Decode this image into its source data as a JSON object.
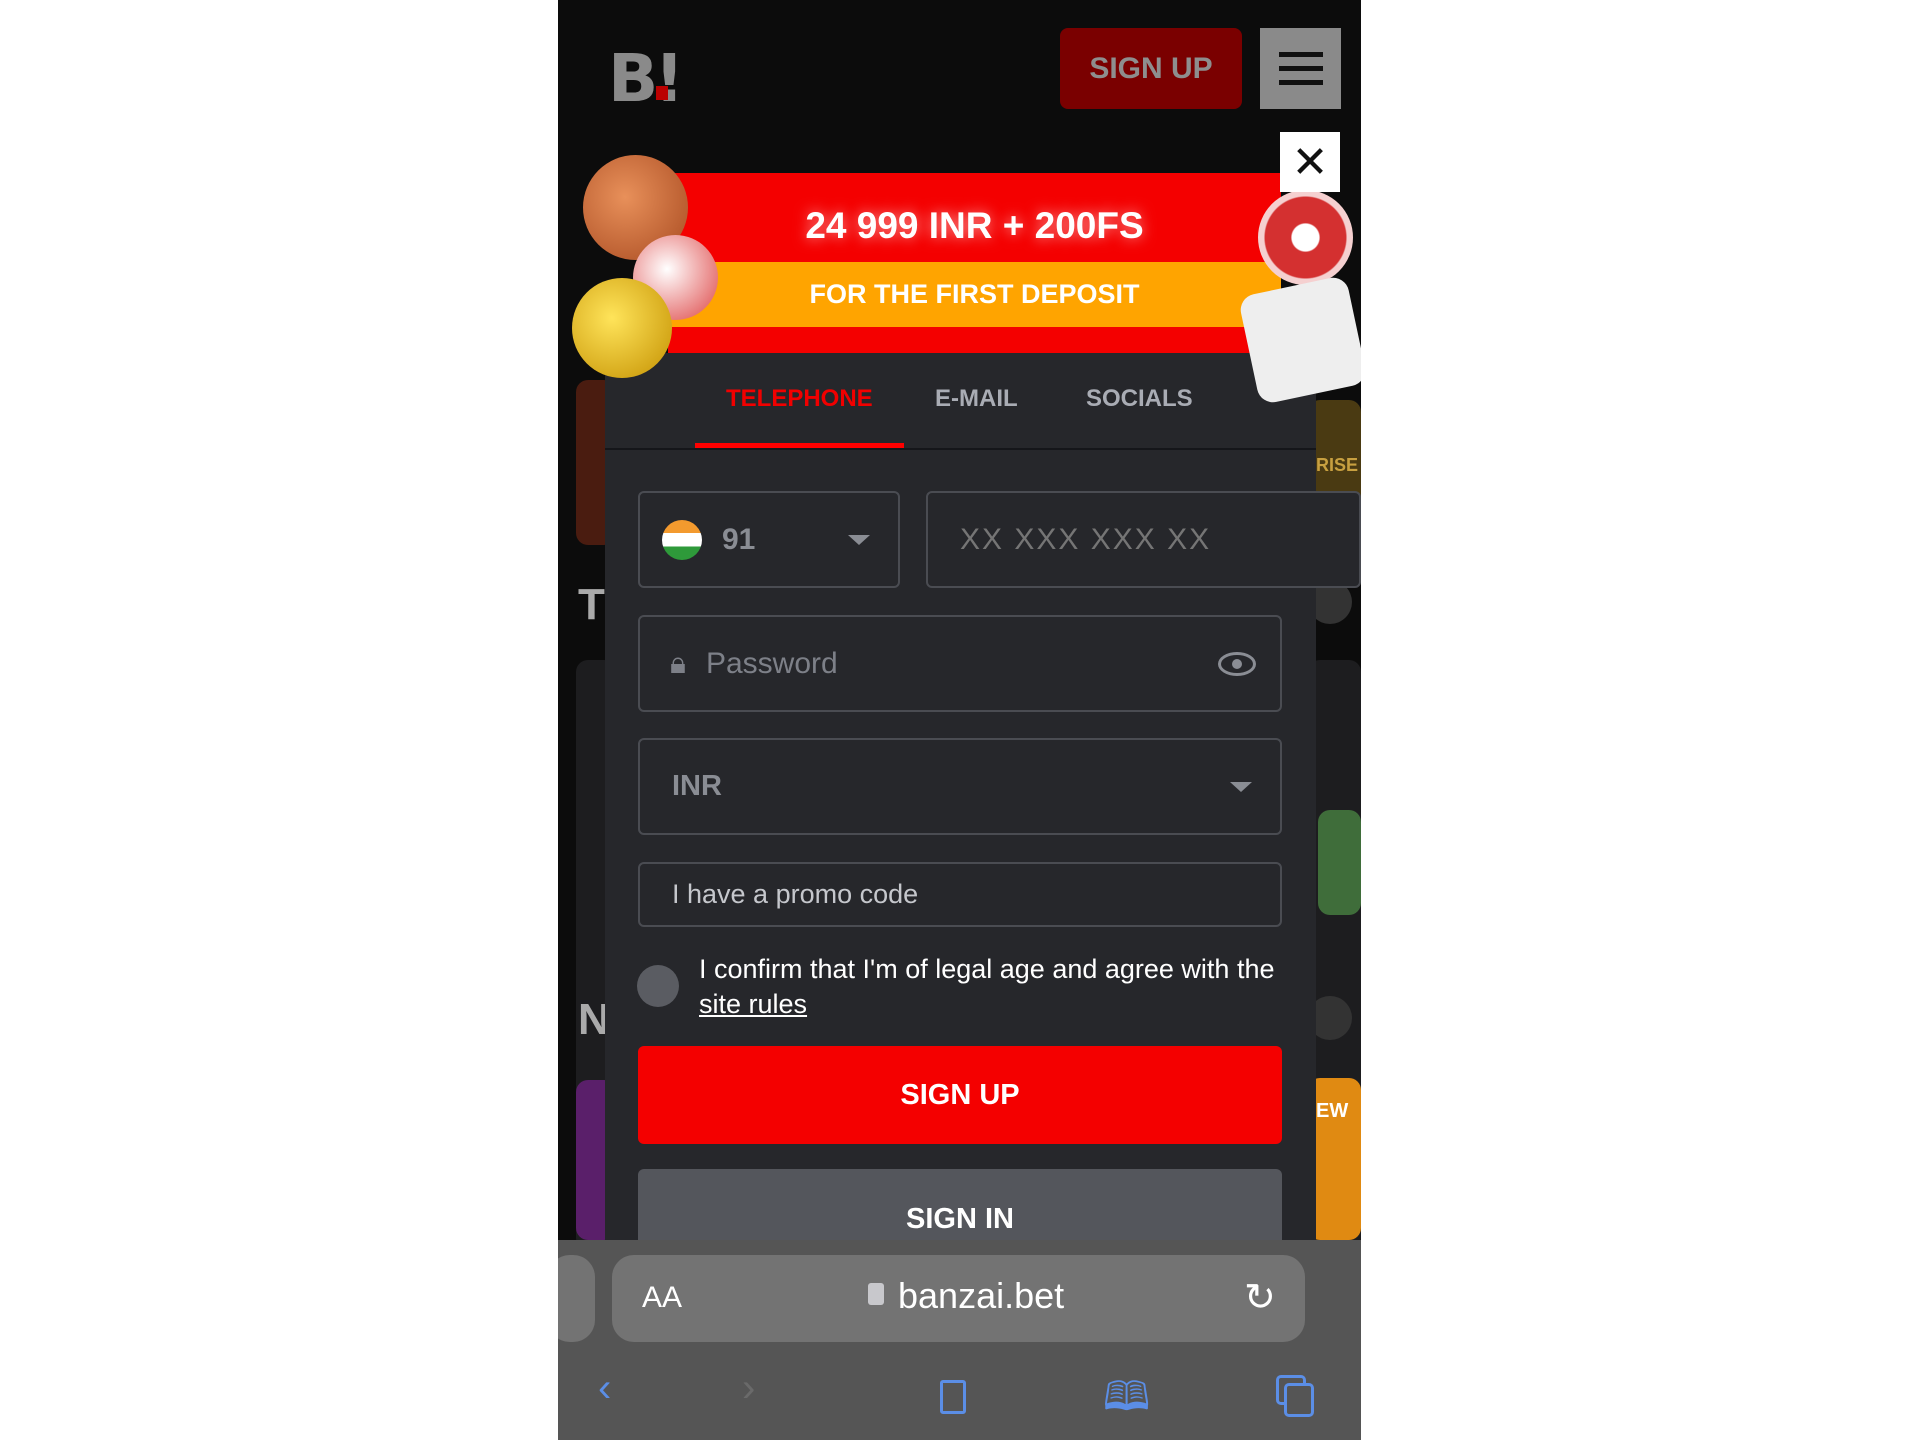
{
  "header": {
    "logo": "B!",
    "signup_label": "SIGN UP",
    "menu_icon": "hamburger-icon"
  },
  "promo": {
    "bonus": "24 999 INR + 200FS",
    "subtitle": "FOR THE FIRST DEPOSIT"
  },
  "tabs": [
    {
      "label": "TELEPHONE",
      "active": true
    },
    {
      "label": "E-MAIL",
      "active": false
    },
    {
      "label": "SOCIALS",
      "active": false
    }
  ],
  "form": {
    "country_code": "91",
    "phone_placeholder": "XX XXX XXX XX",
    "password_placeholder": "Password",
    "currency": "INR",
    "promo_label": "I have a promo code",
    "consent_text": "I confirm that I'm of legal age and agree with the",
    "consent_link": "site rules",
    "signup_label": "SIGN UP",
    "signin_label": "SIGN IN"
  },
  "background": {
    "section_letter_1": "T",
    "section_letter_2": "N",
    "game_text_1": "RISE",
    "game_text_2": "EW"
  },
  "browser": {
    "text_size": "AA",
    "url": "banzai.bet"
  },
  "colors": {
    "accent": "#f40000",
    "banner_stripe": "#ffa400",
    "modal": "#26272b",
    "browser_icons": "#5b8ee6"
  }
}
